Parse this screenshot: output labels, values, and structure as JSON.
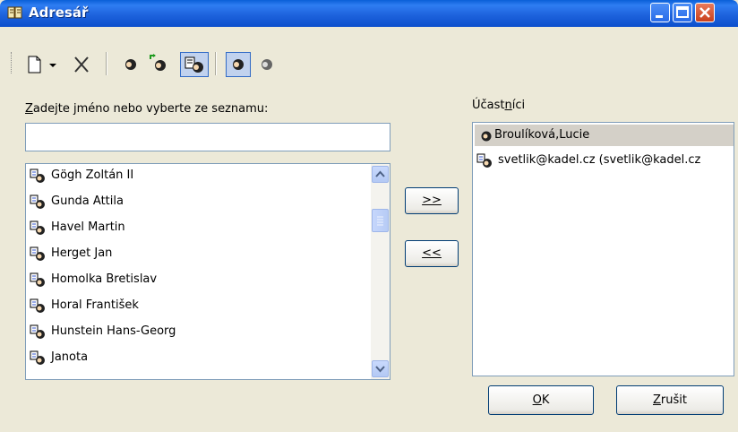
{
  "window": {
    "title": "Adresář",
    "icon": "address-book-icon"
  },
  "toolbar": {
    "buttons": [
      {
        "name": "new-document-icon"
      },
      {
        "name": "dropdown-arrow-icon"
      },
      {
        "name": "delete-icon"
      },
      {
        "name": "contact-properties-icon"
      },
      {
        "name": "new-contact-icon"
      },
      {
        "name": "contact-list-icon",
        "pressed": true
      },
      {
        "name": "single-contact-icon",
        "pressed": true
      },
      {
        "name": "contact-gray-icon"
      }
    ]
  },
  "left": {
    "prompt_prefix": "Z",
    "prompt_rest": "adejte jméno nebo vyberte ze seznamu:",
    "search_value": "",
    "items": [
      "Gögh Zoltán II",
      "Gunda Attila",
      "Havel Martin",
      "Herget Jan",
      "Homolka Bretislav",
      "Horal František",
      "Hunstein Hans-Georg",
      "Janota"
    ]
  },
  "middle": {
    "add_label": ">>",
    "remove_label": "<<"
  },
  "right": {
    "label_pre": "Účast",
    "label_underlined": "n",
    "label_post": "íci",
    "items": [
      {
        "text": "Broulíková,Lucie",
        "selected": true
      },
      {
        "text": "svetlik@kadel.cz (svetlik@kadel.cz",
        "selected": false
      }
    ]
  },
  "footer": {
    "ok_underlined": "O",
    "ok_rest": "K",
    "cancel_underlined": "Z",
    "cancel_rest": "rušit"
  },
  "colors": {
    "titlebar": "#0a5fd8",
    "dialog_bg": "#ece9d8",
    "selection": "#d4d0c8",
    "field_border": "#7f9db9"
  }
}
